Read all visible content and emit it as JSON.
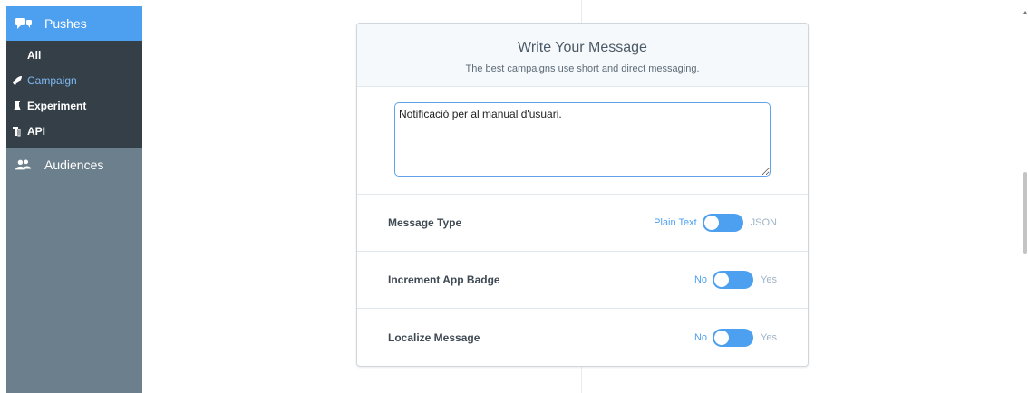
{
  "sidebar": {
    "pushes_label": "Pushes",
    "sub_items": [
      {
        "label": "All"
      },
      {
        "label": "Campaign"
      },
      {
        "label": "Experiment"
      },
      {
        "label": "API"
      }
    ],
    "audiences_label": "Audiences"
  },
  "card": {
    "title": "Write Your Message",
    "subtitle": "The best campaigns use short and direct messaging.",
    "message_value": "Notificació per al manual d'usuari."
  },
  "options": {
    "message_type": {
      "label": "Message Type",
      "left": "Plain Text",
      "right": "JSON"
    },
    "increment_badge": {
      "label": "Increment App Badge",
      "left": "No",
      "right": "Yes"
    },
    "localize": {
      "label": "Localize Message",
      "left": "No",
      "right": "Yes"
    }
  },
  "colors": {
    "accent": "#4d9ff0",
    "sidebar_bg": "#6c7f8c",
    "sidebar_sub_bg": "#353f47"
  }
}
